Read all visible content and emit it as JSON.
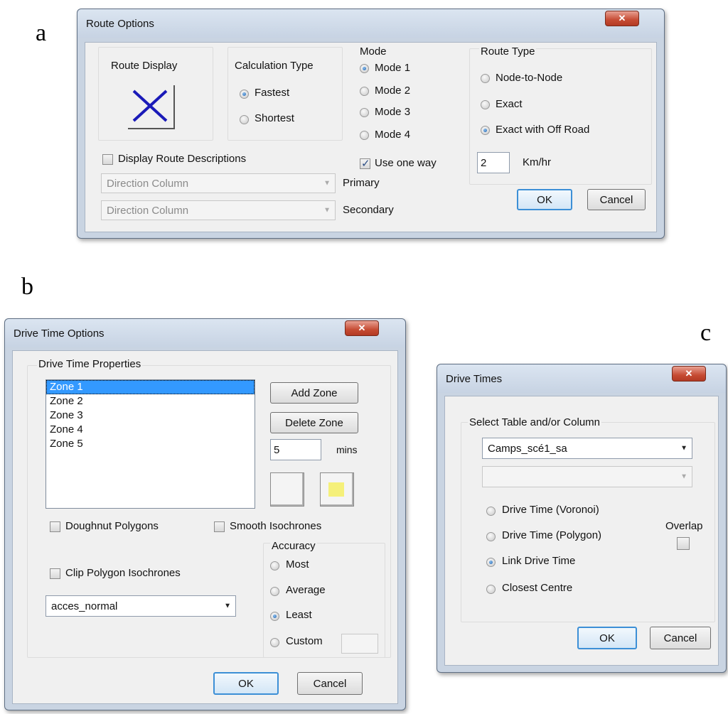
{
  "panels": {
    "a": "a",
    "b": "b",
    "c": "c"
  },
  "route_options": {
    "title": "Route Options",
    "route_display_label": "Route Display",
    "calculation_type": {
      "label": "Calculation Type",
      "fastest": "Fastest",
      "shortest": "Shortest",
      "selected": "fastest"
    },
    "mode": {
      "label": "Mode",
      "options": [
        "Mode 1",
        "Mode 2",
        "Mode 3",
        "Mode 4"
      ],
      "selected": 0
    },
    "use_one_way": "Use one way",
    "route_type": {
      "label": "Route Type",
      "node_to_node": "Node-to-Node",
      "exact": "Exact",
      "exact_off_road": "Exact with Off Road",
      "selected": "exact_off_road"
    },
    "speed_value": "2",
    "speed_unit": "Km/hr",
    "display_descriptions": "Display Route Descriptions",
    "primary_combo": "Direction Column",
    "secondary_combo": "Direction Column",
    "primary_label": "Primary",
    "secondary_label": "Secondary",
    "ok": "OK",
    "cancel": "Cancel",
    "colors": {
      "route_x": "#1a1ab8"
    }
  },
  "drive_time_options": {
    "title": "Drive Time Options",
    "properties_label": "Drive Time Properties",
    "zones": [
      "Zone 1",
      "Zone 2",
      "Zone 3",
      "Zone 4",
      "Zone 5"
    ],
    "selected_zone": "Zone 1",
    "add_zone": "Add Zone",
    "delete_zone": "Delete Zone",
    "minutes_value": "5",
    "minutes_unit": "mins",
    "doughnut": "Doughnut Polygons",
    "smooth": "Smooth Isochrones",
    "clip": "Clip Polygon Isochrones",
    "accuracy": {
      "label": "Accuracy",
      "most": "Most",
      "average": "Average",
      "least": "Least",
      "custom": "Custom",
      "selected": "least"
    },
    "network_combo": "acces_normal",
    "ok": "OK",
    "cancel": "Cancel",
    "colors": {
      "fill_swatch": "#f5f07a"
    }
  },
  "drive_times": {
    "title": "Drive Times",
    "select_label": "Select Table and/or Column",
    "table_combo": "Camps_scé1_sa",
    "column_combo": "",
    "options": {
      "voronoi": "Drive Time (Voronoi)",
      "polygon": "Drive Time (Polygon)",
      "link": "Link Drive Time",
      "closest": "Closest Centre",
      "selected": "link"
    },
    "overlap": "Overlap",
    "ok": "OK",
    "cancel": "Cancel"
  }
}
